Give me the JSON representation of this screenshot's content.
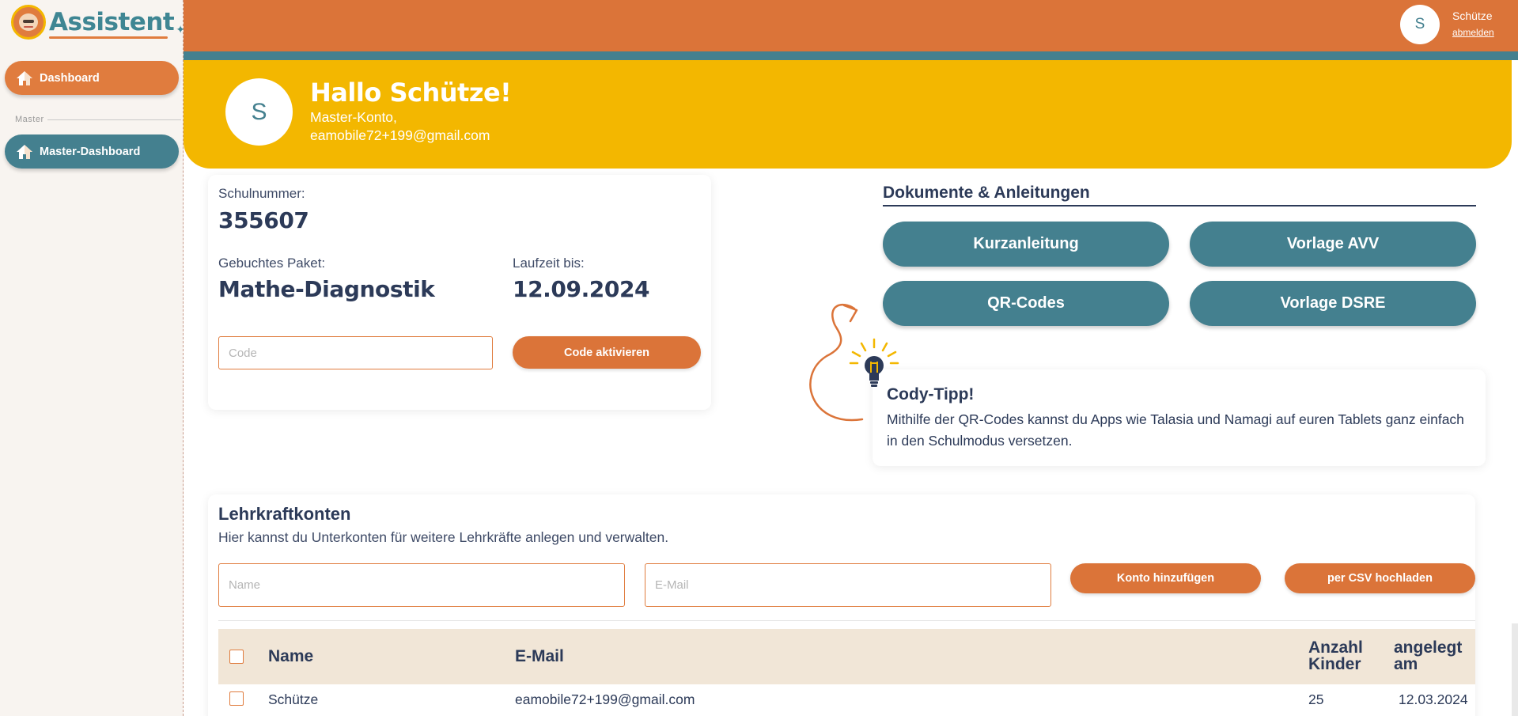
{
  "app": {
    "logo_text": "Assistent"
  },
  "sidebar": {
    "dashboard_label": "Dashboard",
    "section_label": "Master",
    "master_dashboard_label": "Master-Dashboard"
  },
  "user": {
    "initial": "S",
    "name": "Schütze",
    "logout_label": "abmelden"
  },
  "banner": {
    "avatar_initial": "S",
    "greeting": "Hallo Schütze!",
    "account_type": "Master-Konto,",
    "email": "eamobile72+199@gmail.com"
  },
  "school": {
    "number_label": "Schulnummer:",
    "number_value": "355607",
    "package_label": "Gebuchtes Paket:",
    "package_value": "Mathe-Diagnostik",
    "runtime_label": "Laufzeit bis:",
    "runtime_value": "12.09.2024",
    "code_placeholder": "Code",
    "code_value": "",
    "activate_label": "Code aktivieren"
  },
  "documents": {
    "title": "Dokumente & Anleitungen",
    "buttons": [
      "Kurzanleitung",
      "Vorlage AVV",
      "QR-Codes",
      "Vorlage DSRE"
    ]
  },
  "tip": {
    "title": "Cody-Tipp!",
    "text": "Mithilfe der QR-Codes kannst du Apps wie Talasia und Namagi auf euren Tablets ganz einfach in den Schulmodus versetzen."
  },
  "teachers": {
    "title": "Lehrkraftkonten",
    "subtitle": "Hier kannst du Unterkonten für weitere Lehrkräfte anlegen und verwalten.",
    "name_placeholder": "Name",
    "email_placeholder": "E-Mail",
    "add_label": "Konto hinzufügen",
    "csv_label": "per CSV hochladen",
    "columns": {
      "name": "Name",
      "email": "E-Mail",
      "children_line1": "Anzahl",
      "children_line2": "Kinder",
      "created_line1": "angelegt",
      "created_line2": "am"
    },
    "rows": [
      {
        "name": "Schütze",
        "email": "eamobile72+199@gmail.com",
        "children": "25",
        "created": "12.03.2024"
      }
    ]
  },
  "colors": {
    "orange": "#db7439",
    "teal": "#44808f",
    "yellow": "#f3b700",
    "navy_text": "#2c3a58",
    "table_header_bg": "#f1e6d7"
  },
  "icons": [
    "house-icon",
    "lightbulb-icon",
    "curved-arrow-icon",
    "checkbox-icon"
  ]
}
